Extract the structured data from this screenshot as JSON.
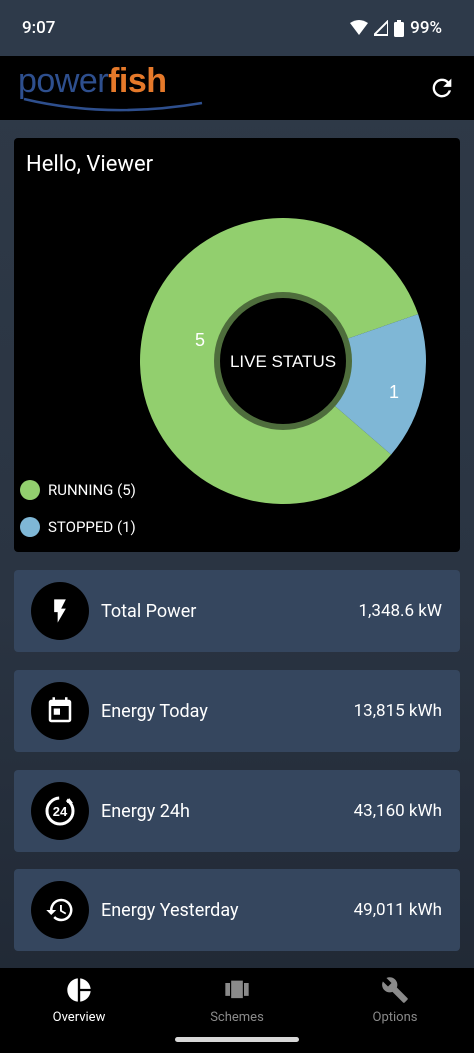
{
  "status_bar": {
    "time": "9:07",
    "battery": "99%"
  },
  "app": {
    "logo_power": "power",
    "logo_fish": "fish"
  },
  "live_status": {
    "greeting": "Hello, Viewer",
    "center_label": "LIVE STATUS",
    "running_count": "5",
    "stopped_count": "1",
    "legend_running": "RUNNING (5)",
    "legend_stopped": "STOPPED (1)"
  },
  "chart_data": {
    "type": "pie",
    "categories": [
      "RUNNING",
      "STOPPED"
    ],
    "values": [
      5,
      1
    ],
    "colors": [
      "#92cf6e",
      "#7fb7d6"
    ],
    "title": "LIVE STATUS",
    "legend": "bottom-left"
  },
  "metrics": [
    {
      "label": "Total Power",
      "value": "1,348.6 kW",
      "icon": "bolt-icon"
    },
    {
      "label": "Energy Today",
      "value": "13,815 kWh",
      "icon": "calendar-icon"
    },
    {
      "label": "Energy 24h",
      "value": "43,160 kWh",
      "icon": "24h-icon"
    },
    {
      "label": "Energy Yesterday",
      "value": "49,011 kWh",
      "icon": "history-icon"
    }
  ],
  "nav": [
    {
      "label": "Overview",
      "icon": "pie-chart-icon",
      "active": true
    },
    {
      "label": "Schemes",
      "icon": "schemes-icon",
      "active": false
    },
    {
      "label": "Options",
      "icon": "tools-icon",
      "active": false
    }
  ]
}
